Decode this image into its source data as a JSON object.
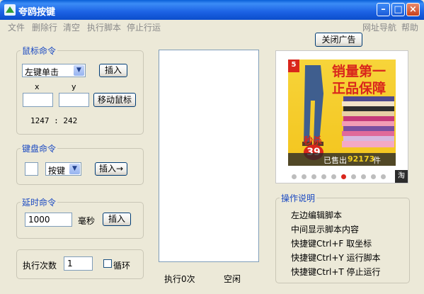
{
  "window": {
    "title": "夸鸥按键"
  },
  "menu": {
    "file": "文件",
    "delete_line": "删除行",
    "clear": "清空",
    "run_script": "执行脚本",
    "stop": "停止行运",
    "nav": "网址导航",
    "help": "帮助"
  },
  "close_ad_label": "关闭广告",
  "mouse": {
    "title": "鼠标命令",
    "action_selected": "左键单击",
    "insert_label": "插入",
    "x_label": "x",
    "y_label": "y",
    "x_value": "",
    "y_value": "",
    "move_label": "移动鼠标",
    "coords": "1247 : 242"
  },
  "keyboard": {
    "title": "键盘命令",
    "key_value": "",
    "key_selected": "按键",
    "insert_label": "插入→"
  },
  "delay": {
    "title": "延时命令",
    "value": "1000",
    "unit": "毫秒",
    "insert_label": "插入"
  },
  "exec": {
    "count_label": "执行次数",
    "count_value": "1",
    "loop_label": "循环",
    "loop_checked": false
  },
  "status": {
    "exec_count": "执行0次",
    "state": "空闲"
  },
  "ad": {
    "badge": "5",
    "headline1": "销量第一",
    "headline2": "正品保障",
    "promo": "秒杀",
    "price": "39",
    "sold_prefix": "已售出",
    "sold_count": "92173",
    "sold_suffix": "件",
    "shop": "淘",
    "active_dot": 5,
    "dot_count": 10
  },
  "instructions": {
    "title": "操作说明",
    "lines": [
      "左边编辑脚本",
      "中间显示脚本内容",
      "快捷键Ctrl+F 取坐标",
      "快捷键Ctrl+Y 运行脚本",
      "快捷键Ctrl+T 停止运行"
    ]
  },
  "colors": {
    "titlebar": "#1C62E4",
    "group_title": "#1A49C2",
    "ad_red": "#D9261C",
    "ad_yellow": "#F3C51E"
  }
}
